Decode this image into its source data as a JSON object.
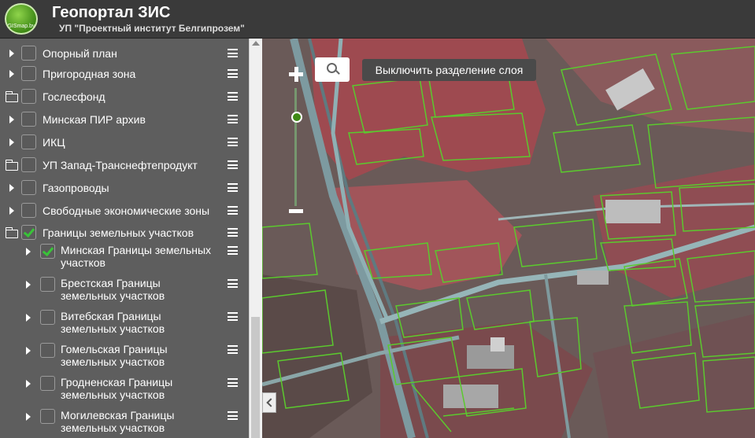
{
  "header": {
    "logo_text": "GISmap.by",
    "title": "Геопортал ЗИС",
    "subtitle": "УП \"Проектный институт Белгипрозем\""
  },
  "layers": [
    {
      "label": "Опорный план",
      "icon": "caret-right-icon",
      "checked": false,
      "indent": 0
    },
    {
      "label": "Пригородная зона",
      "icon": "caret-right-icon",
      "checked": false,
      "indent": 0
    },
    {
      "label": "Гослесфонд",
      "icon": "folder-icon",
      "checked": false,
      "indent": 0
    },
    {
      "label": "Минская ПИР архив",
      "icon": "caret-right-icon",
      "checked": false,
      "indent": 0
    },
    {
      "label": "ИКЦ",
      "icon": "caret-right-icon",
      "checked": false,
      "indent": 0
    },
    {
      "label": "УП Запад-Транснефтепродукт",
      "icon": "folder-icon",
      "checked": false,
      "indent": 0
    },
    {
      "label": "Газопроводы",
      "icon": "caret-right-icon",
      "checked": false,
      "indent": 0
    },
    {
      "label": "Свободные экономические зоны",
      "icon": "caret-right-icon",
      "checked": false,
      "indent": 0
    },
    {
      "label": "Границы земельных участков",
      "icon": "folder-open-icon",
      "checked": true,
      "indent": 0
    },
    {
      "label": "Минская Границы земельных участков",
      "icon": "caret-right-icon",
      "checked": true,
      "indent": 1
    },
    {
      "label": "Брестская Границы земельных участков",
      "icon": "caret-right-icon",
      "checked": false,
      "indent": 1
    },
    {
      "label": "Витебская Границы земельных участков",
      "icon": "caret-right-icon",
      "checked": false,
      "indent": 1
    },
    {
      "label": "Гомельская Границы земельных участков",
      "icon": "caret-right-icon",
      "checked": false,
      "indent": 1
    },
    {
      "label": "Гродненская Границы земельных участков",
      "icon": "caret-right-icon",
      "checked": false,
      "indent": 1
    },
    {
      "label": "Могилевская Границы земельных участков",
      "icon": "caret-right-icon",
      "checked": false,
      "indent": 1
    }
  ],
  "map": {
    "split_button_label": "Выключить разделение слоя",
    "colors": {
      "vegetation": "#b5565a",
      "parcel_lines": "#5bc92e",
      "roads": "#8aa6a8"
    }
  }
}
